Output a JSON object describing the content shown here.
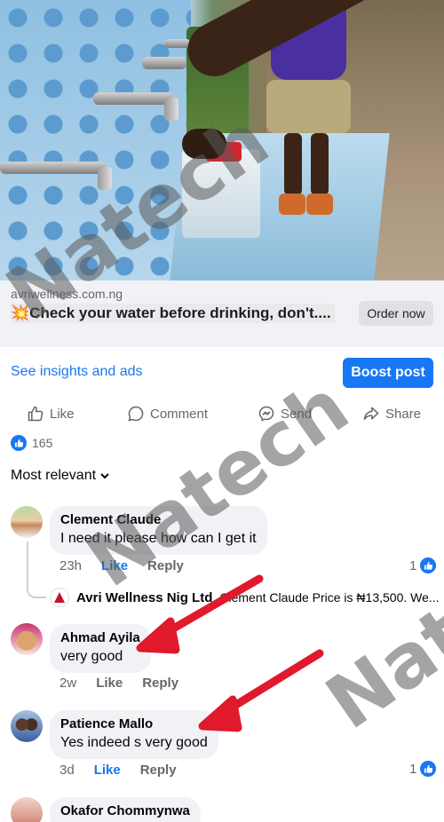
{
  "ad": {
    "domain": "avriwellness.com.ng",
    "title_emoji": "💥",
    "title": "Check your water before drinking, don't....",
    "cta_label": "Order now"
  },
  "insights": {
    "link_label": "See insights and ads",
    "boost_label": "Boost post"
  },
  "actions": {
    "like": "Like",
    "comment": "Comment",
    "send": "Send",
    "share": "Share"
  },
  "reactions": {
    "count": "165"
  },
  "sort_label": "Most relevant",
  "comments": [
    {
      "name": "Clement Claude",
      "text": "I need it please how can I get it",
      "time": "23h",
      "like_label": "Like",
      "reply_label": "Reply",
      "like_count": "1",
      "reply": {
        "name": "Avri Wellness Nig Ltd",
        "text": "Clement Claude Price is ₦13,500. We..."
      }
    },
    {
      "name": "Ahmad Ayila",
      "text": "very good",
      "time": "2w",
      "like_label": "Like",
      "reply_label": "Reply"
    },
    {
      "name": "Patience Mallo",
      "text": "Yes indeed s very good",
      "time": "3d",
      "like_label": "Like",
      "reply_label": "Reply",
      "like_count": "1"
    },
    {
      "name": "Okafor Chommynwa"
    }
  ],
  "watermark": "Natech",
  "colors": {
    "accent": "#1877f2",
    "arrow": "#e0192c",
    "bubble": "#f0f2f5",
    "muted_text": "#65676b"
  }
}
